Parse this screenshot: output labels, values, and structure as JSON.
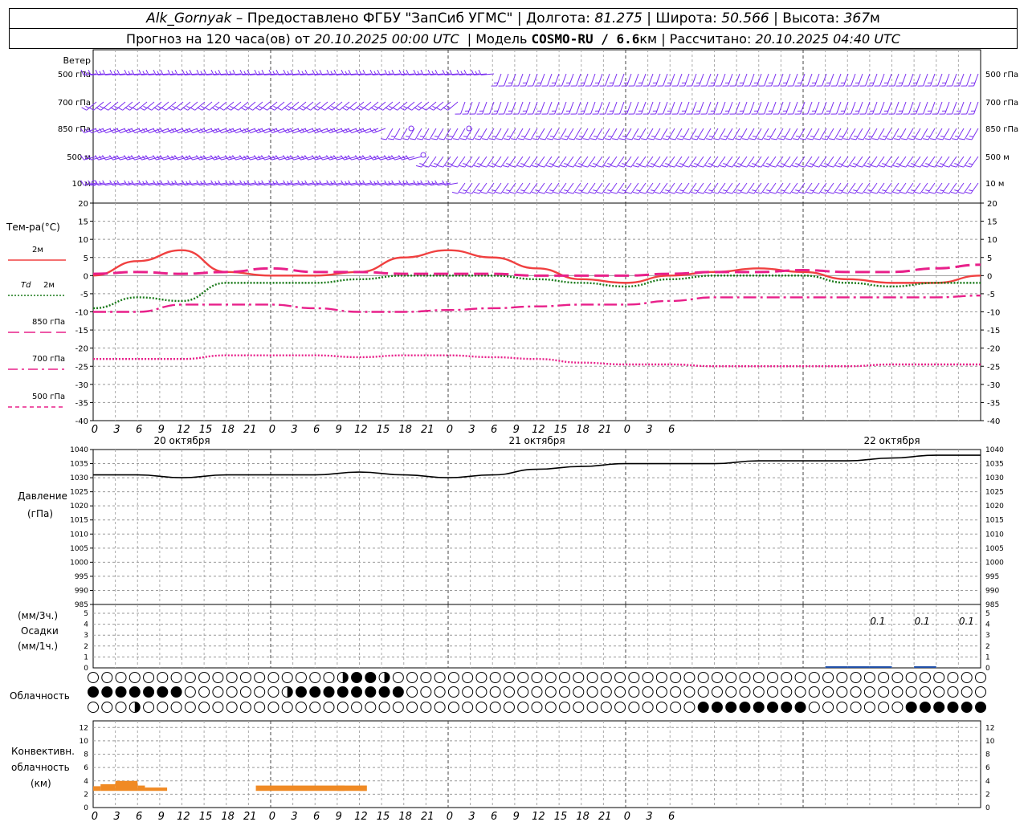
{
  "header": {
    "station": "Alk_Gornyak",
    "provider": " – Предоставлено ФГБУ \"ЗапСиб УГМС\" | Долгота: ",
    "lon": "81.275",
    "lat_label": " | Широта: ",
    "lat": "50.566",
    "alt_label": " | Высота: ",
    "alt": "367",
    "alt_unit": "м",
    "fc_label": "Прогноз на 120 часа(ов) от ",
    "fc_time": "20.10.2025 00:00 UTC",
    "model_label": "  | Модель ",
    "model": "COSMO-RU / 6.6",
    "model_unit": "км",
    "calc_label": " | Рассчитано: ",
    "calc_time": "20.10.2025 04:40 UTC"
  },
  "wind": {
    "label": "Ветер",
    "levels": [
      "500 гПа",
      "700 гПа",
      "850 гПа",
      "500 м",
      "10 м"
    ],
    "color": "#7b2ff0"
  },
  "temp_panel": {
    "label": "Тем-ра(°C)",
    "legend": [
      {
        "label": "2м",
        "prefix": "",
        "color": "#f04040",
        "style": "solid"
      },
      {
        "label": "2м",
        "prefix": "Td",
        "color": "#1a7a1a",
        "style": "dot"
      },
      {
        "label": "850 гПа",
        "prefix": "",
        "color": "#e8208a",
        "style": "longdash"
      },
      {
        "label": "700 гПа",
        "prefix": "",
        "color": "#e8208a",
        "style": "dashdot"
      },
      {
        "label": "500 гПа",
        "prefix": "",
        "color": "#e8208a",
        "style": "dash"
      }
    ],
    "yticks": [
      20,
      15,
      10,
      5,
      0,
      -5,
      -10,
      -15,
      -20,
      -25,
      -30,
      -35,
      -40
    ]
  },
  "pressure_panel": {
    "label": "Давление",
    "unit": "(гПа)",
    "yticks": [
      1040,
      1035,
      1030,
      1025,
      1020,
      1015,
      1010,
      1005,
      1000,
      995,
      990,
      985
    ]
  },
  "precip_panel": {
    "label_top": "(мм/3ч.)",
    "label_mid": "Осадки",
    "label_bot": "(мм/1ч.)",
    "yticks": [
      5,
      4,
      3,
      2,
      1,
      0
    ],
    "annotations": [
      "0.1",
      "0.1",
      "0.1"
    ]
  },
  "cloud_panel": {
    "label": "Облачность"
  },
  "conv_panel": {
    "label1": "Конвективн.",
    "label2": "облачность",
    "label3": "(км)",
    "yticks": [
      12,
      10,
      8,
      6,
      4,
      2,
      0
    ],
    "color": "#f08a24"
  },
  "xaxis": {
    "hour_labels": [
      "0",
      "3",
      "6",
      "9",
      "12",
      "15",
      "18",
      "21",
      "0",
      "3",
      "6",
      "9",
      "12",
      "15",
      "18",
      "21",
      "0",
      "3",
      "6",
      "9",
      "12",
      "15",
      "18",
      "21",
      "0",
      "3",
      "6"
    ],
    "day_labels": [
      "20 октября",
      "21 октября",
      "22 октября"
    ]
  },
  "chart_data": [
    {
      "type": "line",
      "title": "Тем-ра(°C)",
      "x_hours": [
        0,
        6,
        12,
        18,
        24,
        30,
        36,
        42,
        48,
        54,
        60,
        66,
        72,
        78,
        84,
        90,
        96,
        102,
        108,
        114,
        120
      ],
      "ylim": [
        -40,
        20
      ],
      "series": [
        {
          "name": "2м",
          "values": [
            0,
            4,
            7,
            1,
            0,
            0,
            1,
            5,
            7,
            5,
            2,
            -1,
            -2,
            0,
            1,
            2,
            1,
            -1,
            -2,
            -2,
            0
          ]
        },
        {
          "name": "Td 2м",
          "values": [
            -9,
            -6,
            -7,
            -2,
            -2,
            -2,
            -1,
            0,
            0,
            0,
            -1,
            -2,
            -3,
            -1,
            0,
            0,
            0,
            -2,
            -3,
            -2,
            -2
          ]
        },
        {
          "name": "850 гПа",
          "values": [
            0.5,
            1,
            0.5,
            1,
            2,
            1,
            1,
            0.5,
            0.5,
            0.5,
            0,
            0,
            0,
            0.5,
            1,
            1,
            1.5,
            1,
            1,
            2,
            3
          ]
        },
        {
          "name": "700 гПа",
          "values": [
            -10,
            -10,
            -8,
            -8,
            -8,
            -9,
            -10,
            -10,
            -9.5,
            -9,
            -8.5,
            -8,
            -8,
            -7,
            -6,
            -6,
            -6,
            -6,
            -6,
            -6,
            -5.5
          ]
        },
        {
          "name": "500 гПа",
          "values": [
            -23,
            -23,
            -23,
            -22,
            -22,
            -22,
            -22.5,
            -22,
            -22,
            -22.5,
            -23,
            -24,
            -24.5,
            -24.5,
            -25,
            -25,
            -25,
            -25,
            -24.5,
            -24.5,
            -24.5
          ]
        }
      ]
    },
    {
      "type": "line",
      "title": "Давление",
      "x_hours": [
        0,
        6,
        12,
        18,
        24,
        30,
        36,
        42,
        48,
        54,
        60,
        66,
        72,
        78,
        84,
        90,
        96,
        102,
        108,
        114,
        120
      ],
      "ylim": [
        985,
        1040
      ],
      "series": [
        {
          "name": "Давление",
          "values": [
            1031,
            1031,
            1030,
            1031,
            1031,
            1031,
            1032,
            1031,
            1030,
            1031,
            1033,
            1034,
            1035,
            1035,
            1035,
            1036,
            1036,
            1036,
            1037,
            1038,
            1038
          ]
        }
      ]
    },
    {
      "type": "bar",
      "title": "Конвективн. облачность (км)",
      "ylim": [
        0,
        13
      ],
      "bars": [
        {
          "start": 0,
          "end": 1,
          "bottom": 2.5,
          "top": 3.2
        },
        {
          "start": 1,
          "end": 3,
          "bottom": 2.5,
          "top": 3.5
        },
        {
          "start": 3,
          "end": 6,
          "bottom": 2.5,
          "top": 4
        },
        {
          "start": 6,
          "end": 7,
          "bottom": 2.5,
          "top": 3.3
        },
        {
          "start": 7,
          "end": 10,
          "bottom": 2.5,
          "top": 3
        },
        {
          "start": 22,
          "end": 34,
          "bottom": 2.5,
          "top": 3.3
        },
        {
          "start": 33,
          "end": 36,
          "bottom": 2.5,
          "top": 3.3
        },
        {
          "start": 36,
          "end": 37,
          "bottom": 2.5,
          "top": 3.3
        },
        {
          "start": 36,
          "end": 37,
          "bottom": 2.5,
          "top": 3.3
        }
      ]
    }
  ]
}
